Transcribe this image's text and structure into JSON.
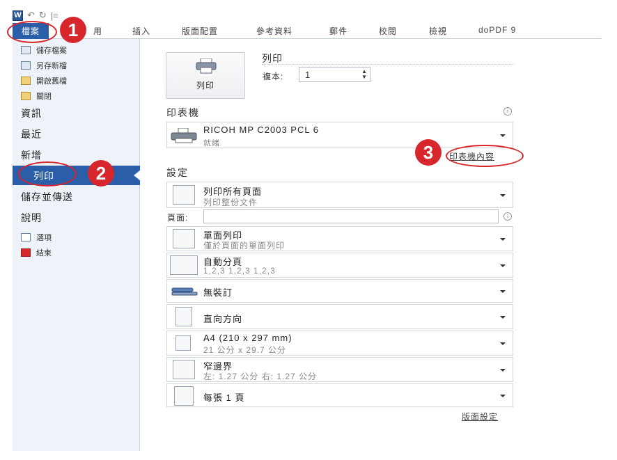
{
  "qat": {
    "app_icon": "W",
    "undo_glyph": "↶",
    "redo_glyph": "↻",
    "sep": "|="
  },
  "ribbon": {
    "file_tab": "檔案",
    "tabs": [
      "用",
      "插入",
      "版面配置",
      "參考資料",
      "郵件",
      "校閱",
      "檢視",
      "doPDF 9"
    ]
  },
  "sidebar": {
    "small_items": [
      "儲存檔案",
      "另存新檔",
      "開啟舊檔",
      "關閉"
    ],
    "big_items": [
      "資訊",
      "最近",
      "新增"
    ],
    "active": "列印",
    "big_items_2": [
      "儲存並傳送",
      "說明"
    ],
    "bottom_items": [
      "選項",
      "結束"
    ]
  },
  "print": {
    "button_label": "列印",
    "title": "列印",
    "copies_label": "複本:",
    "copies_value": "1"
  },
  "printer": {
    "section_title": "印表機",
    "name": "RICOH MP C2003 PCL 6",
    "status": "就緒",
    "properties_link": "印表機內容"
  },
  "settings": {
    "section_title": "設定",
    "pages_label": "頁面:",
    "pages_value": "",
    "options": [
      {
        "main": "列印所有頁面",
        "sub": "列印整份文件"
      },
      {
        "main": "單面列印",
        "sub": "僅於頁面的單面列印"
      },
      {
        "main": "自動分頁",
        "sub": "1,2,3    1,2,3    1,2,3"
      },
      {
        "main": "無裝訂",
        "sub": ""
      },
      {
        "main": "直向方向",
        "sub": ""
      },
      {
        "main": "A4 (210 x 297 mm)",
        "sub": "21 公分 x 29.7 公分"
      },
      {
        "main": "窄邊界",
        "sub": "左: 1.27 公分    右: 1.27 公分"
      },
      {
        "main": "每張 1 頁",
        "sub": ""
      }
    ],
    "page_setup_link": "版面設定"
  },
  "annotations": {
    "badge1": "1",
    "badge2": "2",
    "badge3": "3",
    "color": "#d8262d"
  }
}
